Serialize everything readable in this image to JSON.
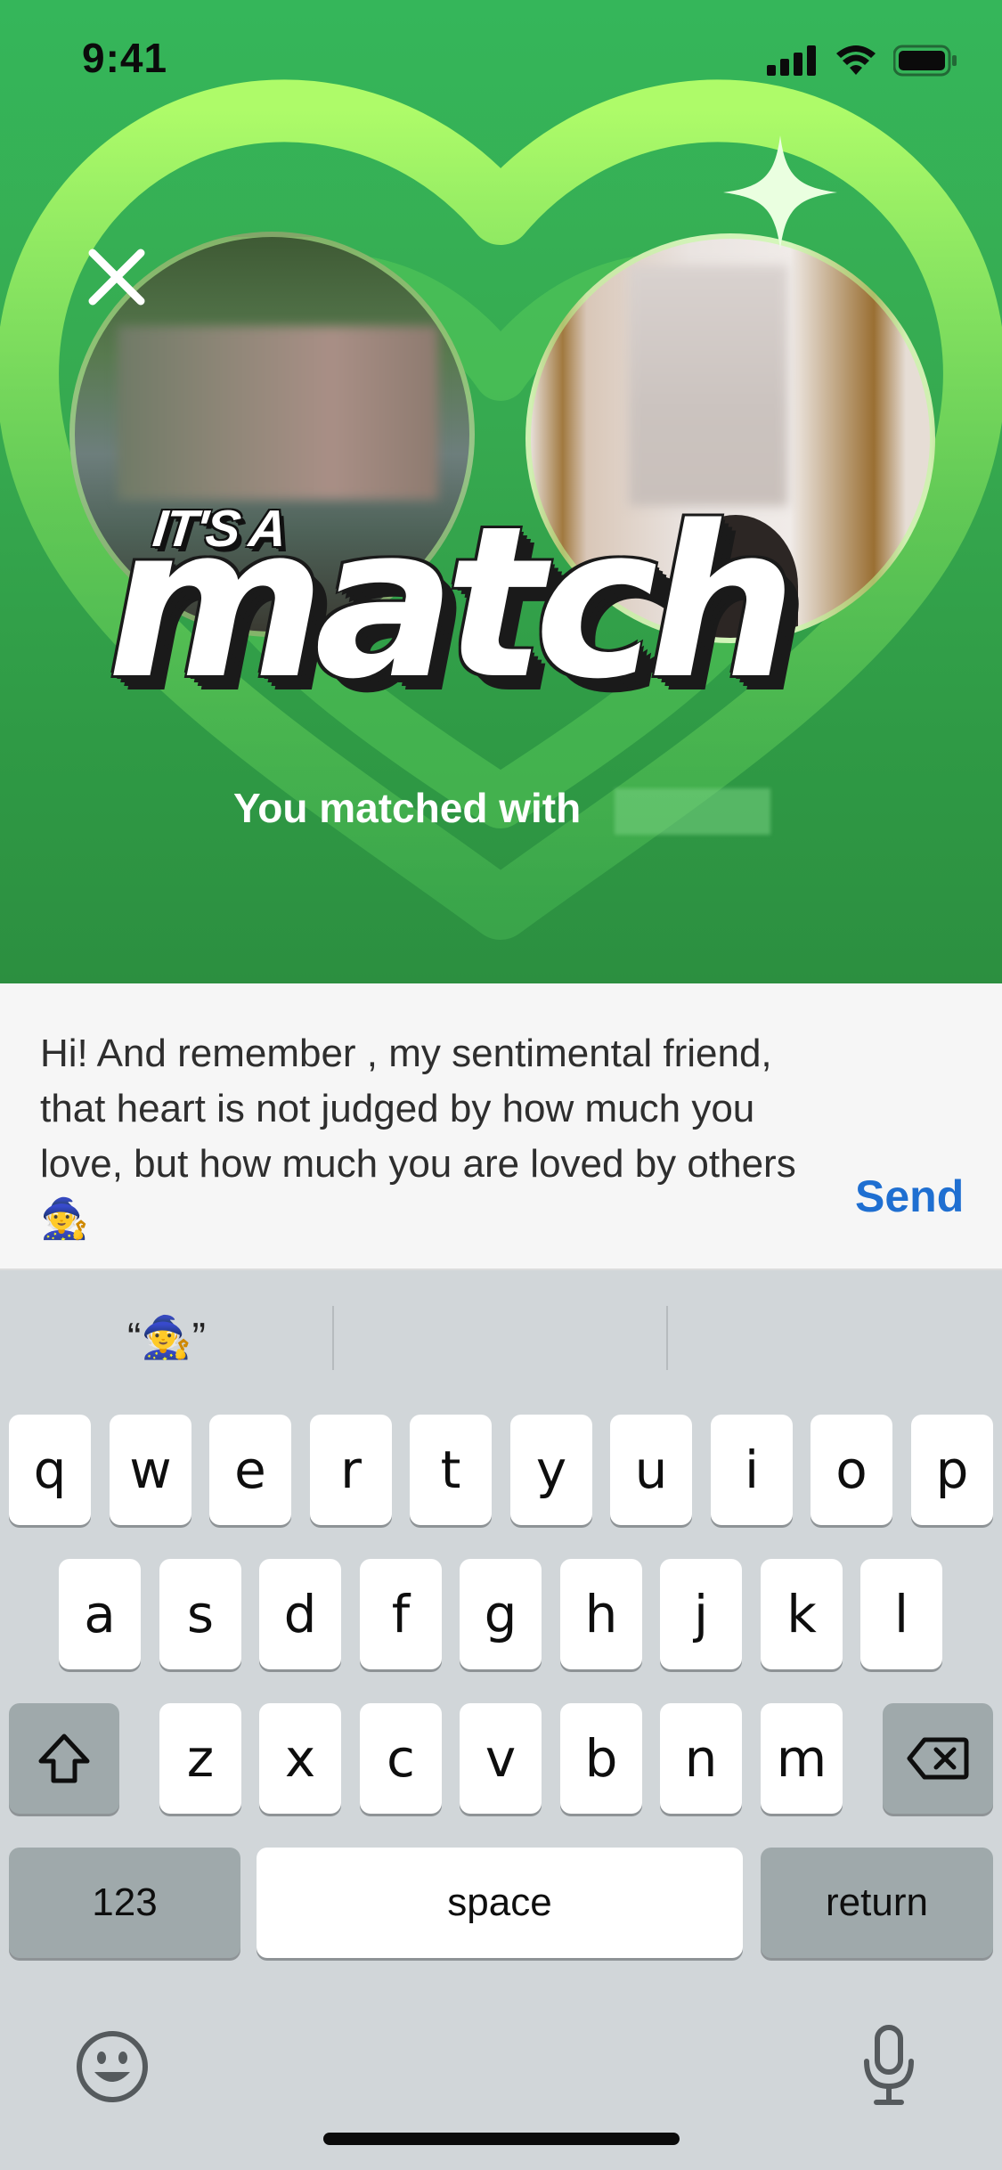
{
  "status_bar": {
    "time": "9:41"
  },
  "match": {
    "headline_small": "IT'S A",
    "headline_big": "match",
    "subtitle": "You matched with"
  },
  "compose": {
    "message": "Hi! And remember , my sentimental friend, that heart is not judged by how much you love, but how much you are loved by others 🧙",
    "send_label": "Send"
  },
  "keyboard": {
    "suggestions": [
      "“🧙”",
      "",
      ""
    ],
    "row1": [
      "q",
      "w",
      "e",
      "r",
      "t",
      "y",
      "u",
      "i",
      "o",
      "p"
    ],
    "row2": [
      "a",
      "s",
      "d",
      "f",
      "g",
      "h",
      "j",
      "k",
      "l"
    ],
    "row3": [
      "z",
      "x",
      "c",
      "v",
      "b",
      "n",
      "m"
    ],
    "numbers_label": "123",
    "space_label": "space",
    "return_label": "return"
  },
  "icons": [
    "close-icon",
    "signal-icon",
    "wifi-icon",
    "battery-icon",
    "sparkle-icon",
    "shift-icon",
    "delete-icon",
    "emoji-icon",
    "microphone-icon"
  ],
  "colors": {
    "accent": "#1f6fd1",
    "hero_green": "#35b65a"
  }
}
